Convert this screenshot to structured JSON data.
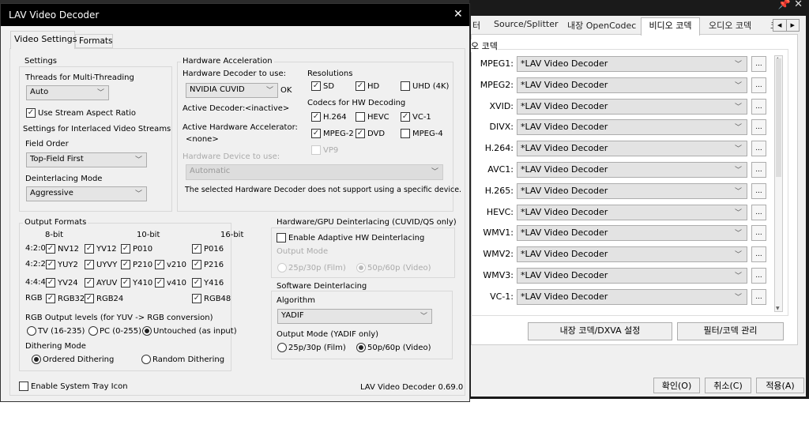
{
  "dialog": {
    "title": "LAV Video Decoder",
    "close": "✕",
    "tabs": [
      "Video Settings",
      "Formats"
    ],
    "settings": {
      "group": "Settings",
      "threads_label": "Threads for Multi-Threading",
      "threads_value": "Auto",
      "stream_aspect": "Use Stream Aspect Ratio",
      "stream_aspect_checked": true,
      "interlaced_label": "Settings for Interlaced Video Streams",
      "field_order_label": "Field Order",
      "field_order_value": "Top-Field First",
      "deint_mode_label": "Deinterlacing Mode",
      "deint_mode_value": "Aggressive"
    },
    "hw": {
      "group": "Hardware Acceleration",
      "decoder_label": "Hardware Decoder to use:",
      "decoder_value": "NVIDIA CUVID",
      "decoder_status": "OK",
      "active_decoder_label": "Active Decoder:",
      "active_decoder_value": "<inactive>",
      "active_accel_label": "Active Hardware Accelerator:",
      "active_accel_value": "<none>",
      "device_label": "Hardware Device to use:",
      "device_value": "Automatic",
      "device_note": "The selected Hardware Decoder does not support using a specific device.",
      "resolutions_label": "Resolutions",
      "resolutions": [
        {
          "label": "SD",
          "checked": true
        },
        {
          "label": "HD",
          "checked": true
        },
        {
          "label": "UHD (4K)",
          "checked": false
        }
      ],
      "codecs_label": "Codecs for HW Decoding",
      "codecs": [
        {
          "label": "H.264",
          "checked": true
        },
        {
          "label": "HEVC",
          "checked": false
        },
        {
          "label": "VC-1",
          "checked": true
        },
        {
          "label": "MPEG-2",
          "checked": true
        },
        {
          "label": "DVD",
          "checked": true
        },
        {
          "label": "MPEG-4",
          "checked": false
        },
        {
          "label": "VP9",
          "checked": false
        }
      ]
    },
    "output": {
      "group": "Output Formats",
      "bit_headers": [
        "8-bit",
        "10-bit",
        "16-bit"
      ],
      "row_labels": [
        "4:2:0",
        "4:2:2",
        "4:4:4",
        "RGB"
      ],
      "formats": [
        {
          "label": "NV12",
          "checked": true
        },
        {
          "label": "YV12",
          "checked": true
        },
        {
          "label": "P010",
          "checked": true
        },
        {
          "label": "P016",
          "checked": true
        },
        {
          "label": "YUY2",
          "checked": true
        },
        {
          "label": "UYVY",
          "checked": true
        },
        {
          "label": "P210",
          "checked": true
        },
        {
          "label": "v210",
          "checked": true
        },
        {
          "label": "P216",
          "checked": true
        },
        {
          "label": "YV24",
          "checked": true
        },
        {
          "label": "AYUV",
          "checked": true
        },
        {
          "label": "Y410",
          "checked": true
        },
        {
          "label": "v410",
          "checked": true
        },
        {
          "label": "Y416",
          "checked": true
        },
        {
          "label": "RGB32",
          "checked": true
        },
        {
          "label": "RGB24",
          "checked": true
        },
        {
          "label": "RGB48",
          "checked": true
        }
      ],
      "rgb_levels_label": "RGB Output levels (for YUV -> RGB conversion)",
      "rgb_levels": [
        {
          "label": "TV (16-235)",
          "selected": false
        },
        {
          "label": "PC (0-255)",
          "selected": false
        },
        {
          "label": "Untouched (as input)",
          "selected": true
        }
      ],
      "dither_label": "Dithering Mode",
      "dither": [
        {
          "label": "Ordered Dithering",
          "selected": true
        },
        {
          "label": "Random Dithering",
          "selected": false
        }
      ]
    },
    "hwdeint": {
      "group": "Hardware/GPU Deinterlacing (CUVID/QS only)",
      "enable": "Enable Adaptive HW Deinterlacing",
      "enable_checked": false,
      "mode_label": "Output Mode",
      "modes": [
        {
          "label": "25p/30p (Film)",
          "selected": false
        },
        {
          "label": "50p/60p (Video)",
          "selected": true
        }
      ]
    },
    "swdeint": {
      "group": "Software Deinterlacing",
      "algo_label": "Algorithm",
      "algo_value": "YADIF",
      "mode_label": "Output Mode (YADIF only)",
      "modes": [
        {
          "label": "25p/30p (Film)",
          "selected": false
        },
        {
          "label": "50p/60p (Video)",
          "selected": true
        }
      ]
    },
    "tray": "Enable System Tray Icon",
    "tray_checked": false,
    "version": "LAV Video Decoder 0.69.0"
  },
  "right": {
    "tabs": [
      "터",
      "Source/Splitter",
      "내장 OpenCodec",
      "비디오 코덱",
      "오디오 코덱",
      "코"
    ],
    "active_tab": "비디오 코덱",
    "group": "오 코덱",
    "codecs": [
      {
        "label": "MPEG1:",
        "value": "*LAV Video Decoder"
      },
      {
        "label": "MPEG2:",
        "value": "*LAV Video Decoder"
      },
      {
        "label": "XVID:",
        "value": "*LAV Video Decoder"
      },
      {
        "label": "DIVX:",
        "value": "*LAV Video Decoder"
      },
      {
        "label": "H.264:",
        "value": "*LAV Video Decoder"
      },
      {
        "label": "AVC1:",
        "value": "*LAV Video Decoder"
      },
      {
        "label": "H.265:",
        "value": "*LAV Video Decoder"
      },
      {
        "label": "HEVC:",
        "value": "*LAV Video Decoder"
      },
      {
        "label": "WMV1:",
        "value": "*LAV Video Decoder"
      },
      {
        "label": "WMV2:",
        "value": "*LAV Video Decoder"
      },
      {
        "label": "WMV3:",
        "value": "*LAV Video Decoder"
      },
      {
        "label": "VC-1:",
        "value": "*LAV Video Decoder"
      }
    ],
    "more": "...",
    "dxva_button": "내장 코덱/DXVA 설정",
    "manage_button": "필터/코덱 관리",
    "ok": "확인(O)",
    "cancel": "취소(C)",
    "apply": "적용(A)"
  }
}
